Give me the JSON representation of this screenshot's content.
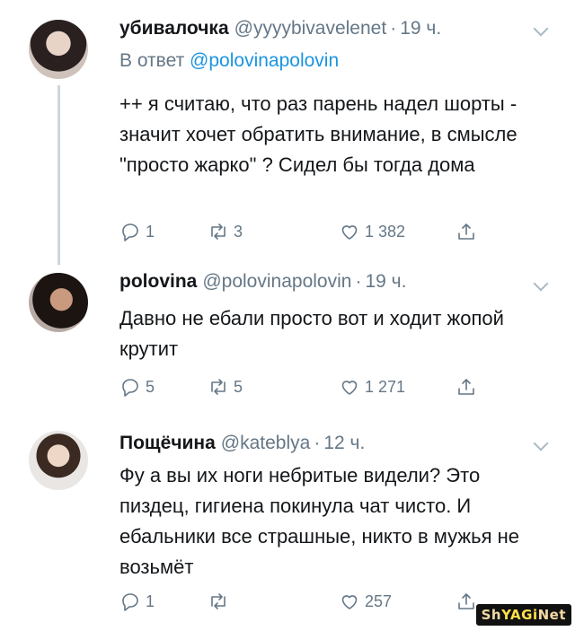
{
  "tweets": [
    {
      "name": "убивалочка",
      "handle": "@yyyybivavelenet",
      "dot": "·",
      "time": "19 ч.",
      "reply_prefix": "В ответ",
      "reply_mention": "@polovinapolovin",
      "text": "++ я считаю, что раз парень надел шорты - значит хочет обратить внимание, в смысле \"просто жарко\" ? Сидел бы тогда дома",
      "replies": "1",
      "retweets": "3",
      "likes": "1 382"
    },
    {
      "name": "polovina",
      "handle": "@polovinapolovin",
      "dot": "·",
      "time": "19 ч.",
      "text": "Давно не ебали просто вот и ходит жопой крутит",
      "replies": "5",
      "retweets": "5",
      "likes": "1 271"
    },
    {
      "name": "Пощёчина",
      "handle": "@kateblya",
      "dot": "·",
      "time": "12 ч.",
      "text": "Фу а вы их ноги небритые видели? Это пиздец, гигиена покинула чат чисто. И ебальники все страшные, никто в мужья не возьмёт",
      "replies": "1",
      "retweets": "",
      "likes": "257"
    }
  ],
  "watermark": {
    "part1": "Sh",
    "part2": "YAGi",
    "part3": "Net"
  },
  "colors": {
    "link": "#1b95e0",
    "secondary": "#657786",
    "icon": "#657786"
  }
}
